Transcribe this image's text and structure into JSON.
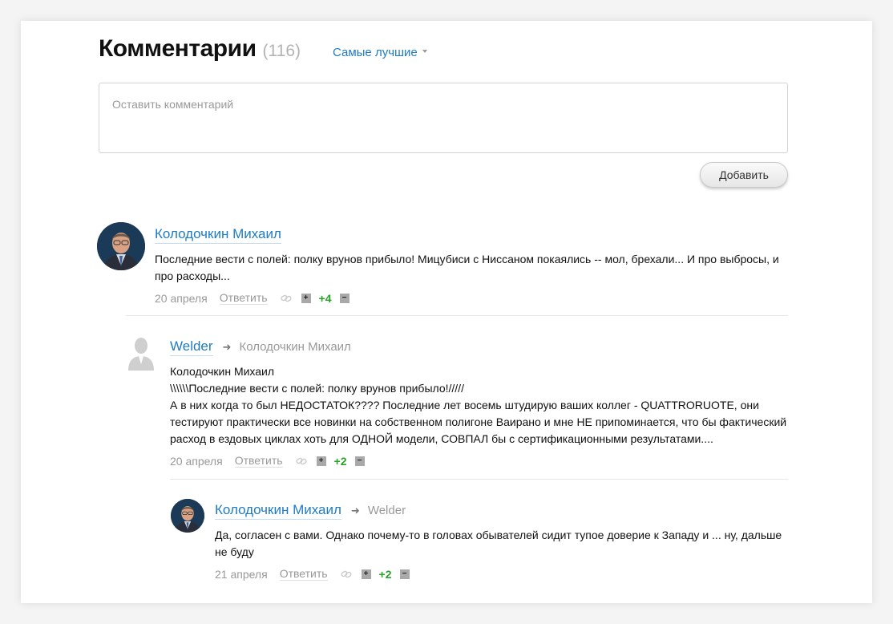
{
  "header": {
    "title": "Комментарии",
    "count": "(116)",
    "sort_label": "Самые лучшие"
  },
  "comment_form": {
    "placeholder": "Оставить комментарий",
    "submit_label": "Добавить"
  },
  "comments": [
    {
      "author": "Колодочкин Михаил",
      "reply_to": "",
      "text_lines": [
        "Последние вести с полей: полку врунов прибыло! Мицубиси с Ниссаном покаялись -- мол, брехали... И про выбросы, и",
        "про расходы..."
      ],
      "date": "20 апреля",
      "reply_label": "Ответить",
      "plus": "+",
      "score": "+4",
      "minus": "−",
      "avatar": "photo"
    },
    {
      "author": "Welder",
      "reply_to": "Колодочкин Михаил",
      "text_lines": [
        "Колодочкин Михаил",
        "\\\\\\\\\\\\Последние вести с полей: полку врунов прибыло!/////",
        "А в них когда то был НЕДОСТАТОК???? Последние лет восемь штудирую ваших коллег - QUATTRORUOTE, они",
        "тестируют практически все новинки на собственном полигоне Ваирано и мне НЕ припоминается, что бы фактический",
        "расход в ездовых циклах хоть для ОДНОЙ модели, СОВПАЛ бы с сертификационными результатами...."
      ],
      "date": "20 апреля",
      "reply_label": "Ответить",
      "plus": "+",
      "score": "+2",
      "minus": "−",
      "avatar": "anonymous"
    },
    {
      "author": "Колодочкин Михаил",
      "reply_to": "Welder",
      "text_lines": [
        "Да, согласен с вами. Однако почему-то в головах обывателей сидит тупое доверие к Западу и ... ну, дальше",
        "не буду"
      ],
      "date": "21 апреля",
      "reply_label": "Ответить",
      "plus": "+",
      "score": "+2",
      "minus": "−",
      "avatar": "photo"
    }
  ],
  "icons": {
    "reply_arrow": "arrow-right-icon",
    "permalink": "link-icon",
    "sort_caret": "caret-down-icon"
  },
  "colors": {
    "link": "#1f7bc4",
    "score_positive": "#27a327",
    "muted": "#999999"
  }
}
